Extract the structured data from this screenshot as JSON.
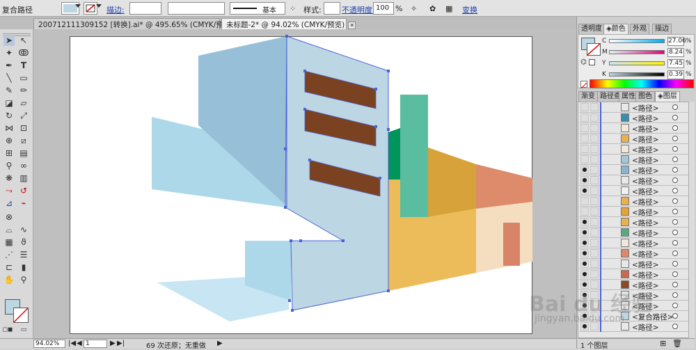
{
  "control_bar": {
    "object_type": "复合路径",
    "stroke_label": "描边:",
    "stroke_profile_label": "基本",
    "style_label": "样式:",
    "opacity_label": "不透明度:",
    "opacity_value": "100",
    "opacity_unit": "%",
    "transform_label": "变换"
  },
  "tabs": [
    {
      "label": "200712111309152 [转换].ai* @ 495.65% (CMYK/预览)",
      "active": false
    },
    {
      "label": "未标题-2* @ 94.02% (CMYK/预览)",
      "active": true
    }
  ],
  "status": {
    "zoom": "94.02%",
    "page": "1",
    "history": "69 次还原；无重做"
  },
  "color_panel": {
    "tabs": [
      "透明度",
      "颜色",
      "外观",
      "描边"
    ],
    "active_tab": "颜色",
    "channels": [
      {
        "label": "C",
        "value": "27.06",
        "unit": "%",
        "level": 0.27
      },
      {
        "label": "M",
        "value": "8.24",
        "unit": "%",
        "level": 0.08
      },
      {
        "label": "Y",
        "value": "7.45",
        "unit": "%",
        "level": 0.07
      },
      {
        "label": "K",
        "value": "0.39",
        "unit": "%",
        "level": 0.004
      }
    ],
    "fill_color": "#bdd6e3"
  },
  "layers_panel": {
    "tabs": [
      "渐变",
      "路径查",
      "属性",
      "图色",
      "图层"
    ],
    "active_tab": "图层",
    "rows": [
      {
        "name": "<路径>",
        "visible": false,
        "thumb": "#e8e8e8"
      },
      {
        "name": "<路径>",
        "visible": false,
        "thumb": "#3c8ea8"
      },
      {
        "name": "<路径>",
        "visible": false,
        "thumb": "#f0e8dc"
      },
      {
        "name": "<路径>",
        "visible": false,
        "thumb": "#e9b251"
      },
      {
        "name": "<路径>",
        "visible": false,
        "thumb": "#f0e8dc"
      },
      {
        "name": "<路径>",
        "visible": false,
        "thumb": "#a6c6d8"
      },
      {
        "name": "<路径>",
        "visible": true,
        "thumb": "#8ab4d0"
      },
      {
        "name": "<路径>",
        "visible": true,
        "thumb": "#e8e8e8"
      },
      {
        "name": "<路径>",
        "visible": true,
        "thumb": "#f0f0f0"
      },
      {
        "name": "<路径>",
        "visible": false,
        "thumb": "#e9b251"
      },
      {
        "name": "<路径>",
        "visible": false,
        "thumb": "#e3a23a"
      },
      {
        "name": "<路径>",
        "visible": true,
        "thumb": "#e9b251"
      },
      {
        "name": "<路径>",
        "visible": true,
        "thumb": "#5aa880"
      },
      {
        "name": "<路径>",
        "visible": true,
        "thumb": "#f0e8dc"
      },
      {
        "name": "<路径>",
        "visible": true,
        "thumb": "#d98a6a"
      },
      {
        "name": "<路径>",
        "visible": true,
        "thumb": "#e8e8e8"
      },
      {
        "name": "<路径>",
        "visible": true,
        "thumb": "#c86a50"
      },
      {
        "name": "<路径>",
        "visible": true,
        "thumb": "#8b4a2a"
      },
      {
        "name": "<路径>",
        "visible": true,
        "thumb": "#e8e8e8"
      },
      {
        "name": "<路径>",
        "visible": true,
        "thumb": "#e8e8e8"
      },
      {
        "name": "<复合路径>",
        "visible": true,
        "thumb": "#bdd6e3"
      },
      {
        "name": "<路径>",
        "visible": true,
        "thumb": "#e8e8e8"
      }
    ],
    "footer": "1 个图层"
  },
  "watermark": {
    "brand": "Bai du 经验",
    "url": "jingyan.baidu.com"
  },
  "colors": {
    "selection": "#4a62d8",
    "left_light_blue": "#acd8ea",
    "tower_front": "#bdd6e3",
    "tower_top": "#97c0d8",
    "windows": "#7a4220",
    "green_sign": "#5bbda0",
    "dark_green": "#00955a",
    "yellow": "#ecbc5a",
    "orange": "#d7a23a",
    "salmon": "#dd8b6a",
    "cream": "#f5ddc0",
    "door": "#d88468"
  }
}
